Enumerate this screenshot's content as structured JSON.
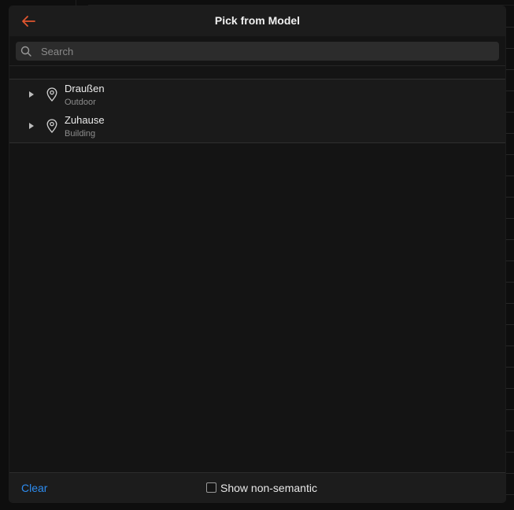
{
  "dialog": {
    "title": "Pick from Model",
    "back_icon": "arrow-left-icon"
  },
  "search": {
    "placeholder": "Search",
    "value": ""
  },
  "tree": {
    "items": [
      {
        "label": "Draußen",
        "type": "Outdoor",
        "icon": "location-pin-icon",
        "expanded": false
      },
      {
        "label": "Zuhause",
        "type": "Building",
        "icon": "location-pin-icon",
        "expanded": false
      }
    ]
  },
  "footer": {
    "clear_label": "Clear",
    "show_non_semantic_label": "Show non-semantic",
    "show_non_semantic_checked": false
  },
  "colors": {
    "accent_back": "#e0562f",
    "link": "#2d8cf0",
    "background": "#141414"
  }
}
